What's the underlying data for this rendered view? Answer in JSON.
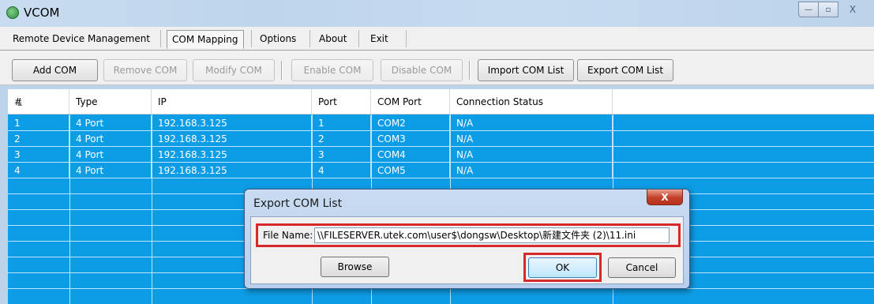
{
  "window": {
    "title": "VCOM"
  },
  "window_controls": {
    "minimize": "—",
    "maximize": "▫",
    "close": "X"
  },
  "menu": {
    "tabs": [
      {
        "label": "Remote Device Management",
        "active": false
      },
      {
        "label": "COM Mapping",
        "active": true
      },
      {
        "label": "Options",
        "active": false
      },
      {
        "label": "About",
        "active": false
      },
      {
        "label": "Exit",
        "active": false
      }
    ]
  },
  "toolbar": {
    "buttons": [
      {
        "label": "Add COM",
        "enabled": true
      },
      {
        "label": "Remove COM",
        "enabled": false
      },
      {
        "label": "Modify COM",
        "enabled": false
      },
      {
        "label": "Enable COM",
        "enabled": false
      },
      {
        "label": "Disable COM",
        "enabled": false
      },
      {
        "label": "Import COM List",
        "enabled": true
      },
      {
        "label": "Export COM List",
        "enabled": true
      }
    ]
  },
  "table": {
    "columns": [
      "#",
      "Type",
      "IP",
      "Port",
      "COM Port",
      "Connection Status"
    ],
    "rows": [
      [
        "1",
        "4 Port",
        "192.168.3.125",
        "1",
        "COM2",
        "N/A"
      ],
      [
        "2",
        "4 Port",
        "192.168.3.125",
        "2",
        "COM3",
        "N/A"
      ],
      [
        "3",
        "4 Port",
        "192.168.3.125",
        "3",
        "COM4",
        "N/A"
      ],
      [
        "4",
        "4 Port",
        "192.168.3.125",
        "4",
        "COM5",
        "N/A"
      ]
    ],
    "selection_color": "#0d9de6"
  },
  "dialog": {
    "title": "Export COM List",
    "close_label": "X",
    "file_name_label": "File Name:",
    "file_name_value": "\\\\FILESERVER.utek.com\\user$\\dongsw\\Desktop\\新建文件夹 (2)\\11.ini",
    "browse_label": "Browse",
    "ok_label": "OK",
    "cancel_label": "Cancel",
    "highlight_color": "#d62a2a"
  }
}
